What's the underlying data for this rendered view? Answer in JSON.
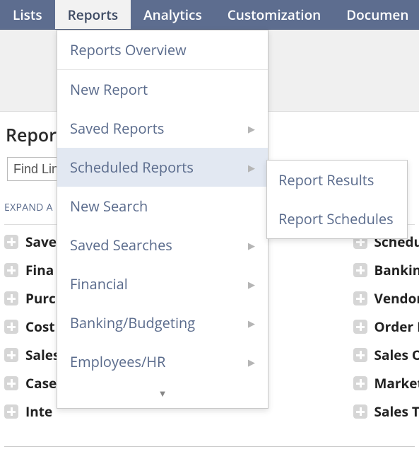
{
  "topnav": {
    "items": [
      {
        "label": "Lists"
      },
      {
        "label": "Reports",
        "active": true
      },
      {
        "label": "Analytics"
      },
      {
        "label": "Customization"
      },
      {
        "label": "Documen"
      }
    ]
  },
  "page": {
    "title": "Report",
    "search_value": "Find Lin",
    "expand_label": "EXPAND A"
  },
  "reports_left": [
    {
      "label": "Save"
    },
    {
      "label": "Fina"
    },
    {
      "label": "Purc"
    },
    {
      "label": "Cost"
    },
    {
      "label": "Sales"
    },
    {
      "label": "Case"
    },
    {
      "label": "Inte"
    }
  ],
  "reports_right": [
    {
      "label": "Scheduled Re"
    },
    {
      "label": "Banking/Bud"
    },
    {
      "label": "Vendors/Paya"
    },
    {
      "label": "Order Manag"
    },
    {
      "label": "Sales Orders"
    },
    {
      "label": "Marketing"
    },
    {
      "label": "Sales Tax US"
    }
  ],
  "menu1": {
    "items": [
      {
        "label": "Reports Overview",
        "divider": true
      },
      {
        "label": "New Report"
      },
      {
        "label": "Saved Reports",
        "submenu": true
      },
      {
        "label": "Scheduled Reports",
        "submenu": true,
        "highlight": true
      },
      {
        "label": "New Search"
      },
      {
        "label": "Saved Searches",
        "submenu": true
      },
      {
        "label": "Financial",
        "submenu": true
      },
      {
        "label": "Banking/Budgeting",
        "submenu": true
      },
      {
        "label": "Employees/HR",
        "submenu": true
      }
    ],
    "more_indicator": "▼"
  },
  "menu2": {
    "items": [
      {
        "label": "Report Results"
      },
      {
        "label": "Report Schedules"
      }
    ]
  }
}
